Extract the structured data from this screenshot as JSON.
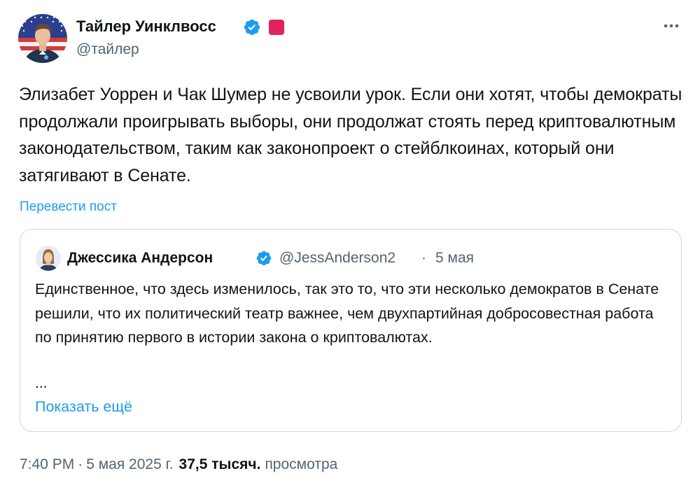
{
  "author": {
    "name": "Тайлер Уинклвосс",
    "handle": "@тайлер",
    "avatar_icon": "person-avatar-icon",
    "verified_icon": "verified-badge-icon",
    "badge_color": "#e0245e"
  },
  "tweet": {
    "text": "Элизабет Уоррен и Чак Шумер не усвоили урок. Если они хотят, чтобы демократы продолжали проигрывать выборы, они продолжат стоять перед криптовалютным законодательством, таким как законопроект о стейблкоинах, который они затягивают в Сенате.",
    "translate_label": "Перевести пост"
  },
  "quote": {
    "name": "Джессика Андерсон",
    "handle": "@JessAnderson2",
    "separator": "·",
    "date": "5 мая",
    "text": "Единственное, что здесь изменилось, так это то, что эти несколько демократов в Сенате решили, что их политический театр важнее, чем двухпартийная добросовестная работа по принятию первого в истории закона о криптовалютах.",
    "ellipsis": "...",
    "show_more_label": "Показать ещё"
  },
  "meta": {
    "time": "7:40 PM",
    "separator": "·",
    "date": "5 мая 2025 г.",
    "views_count": "37,5 тысяч.",
    "views_label": "просмотра"
  },
  "colors": {
    "accent": "#1d9bf0",
    "secondary_text": "#536471",
    "primary_text": "#0f1419",
    "border": "#cfd9de"
  }
}
